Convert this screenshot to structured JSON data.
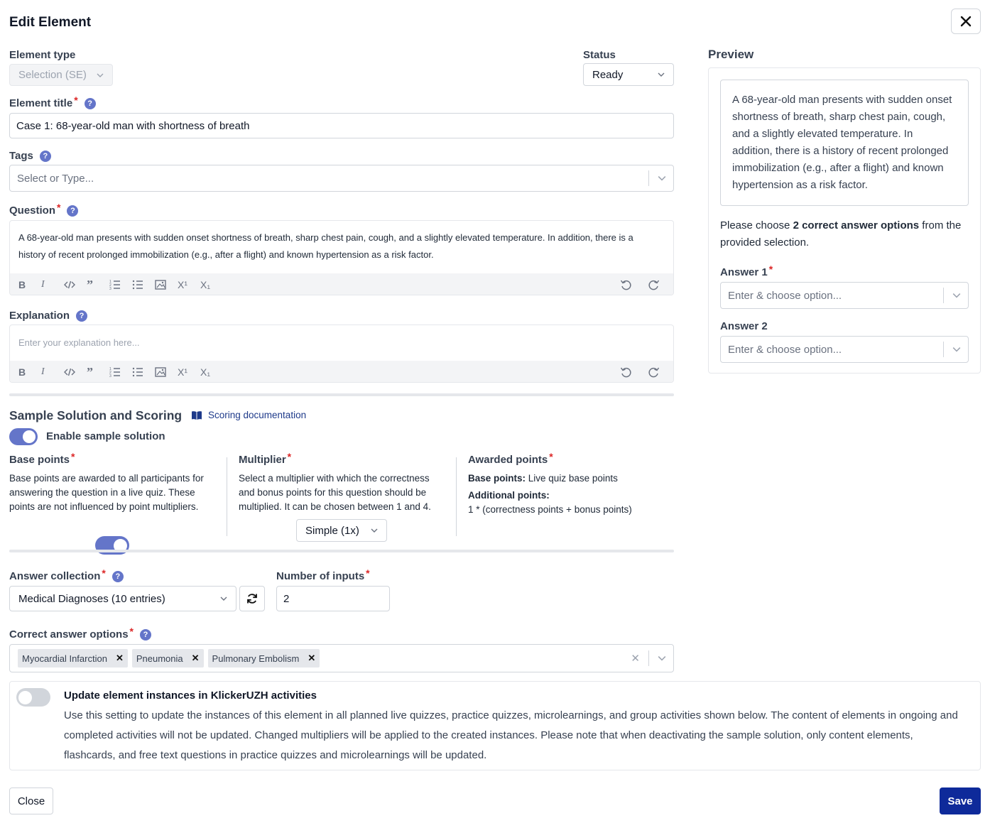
{
  "dialog": {
    "title": "Edit Element",
    "close_icon": "close-icon"
  },
  "element_type": {
    "label": "Element type",
    "value": "Selection (SE)"
  },
  "status": {
    "label": "Status",
    "value": "Ready"
  },
  "element_title": {
    "label": "Element title",
    "required": "*",
    "value": "Case 1: 68-year-old man with shortness of breath"
  },
  "tags": {
    "label": "Tags",
    "placeholder": "Select or Type..."
  },
  "question": {
    "label": "Question",
    "required": "*",
    "line1": "A 68-year-old man presents with sudden onset shortness of breath, sharp chest pain, cough, and a slightly elevated temperature. In addition, there is a",
    "line2": "history of recent prolonged immobilization (e.g., after a flight) and known hypertension as a risk factor."
  },
  "explanation": {
    "label": "Explanation",
    "placeholder": "Enter your explanation here..."
  },
  "toolbar": {
    "bold": "B",
    "italic": "I",
    "superscript": "X¹",
    "subscript": "X₁"
  },
  "scoring": {
    "title": "Sample Solution and Scoring",
    "doc_link": "Scoring documentation",
    "enable_label": "Enable sample solution",
    "base_points_label": "Base points",
    "base_points_desc": "Base points are awarded to all participants for answering the question in a live quiz. These points are not influenced by point multipliers.",
    "multiplier_label": "Multiplier",
    "multiplier_desc": "Select a multiplier with which the correctness and bonus points for this question should be multiplied. It can be chosen between 1 and 4.",
    "multiplier_value": "Simple (1x)",
    "awarded_label": "Awarded points",
    "awarded_base_key": "Base points:",
    "awarded_base_val": "Live quiz base points",
    "awarded_additional_key": "Additional points:",
    "awarded_additional_val": "1 * (correctness points + bonus points)"
  },
  "answer_collection": {
    "label": "Answer collection",
    "value": "Medical Diagnoses (10 entries)"
  },
  "number_of_inputs": {
    "label": "Number of inputs",
    "value": "2"
  },
  "correct_answers": {
    "label": "Correct answer options",
    "items": [
      "Myocardial Infarction",
      "Pneumonia",
      "Pulmonary Embolism"
    ]
  },
  "update_instances": {
    "title": "Update element instances in KlickerUZH activities",
    "line1": "Use this setting to update the instances of this element in all planned live quizzes, practice quizzes, microlearnings, and group activities shown below. The content of elements in ongoing and",
    "line2": "completed activities will not be updated. Changed multipliers will be applied to the created instances. Please note that when deactivating the sample solution, only content elements,",
    "line3": "flashcards, and free text questions in practice quizzes and microlearnings will be updated."
  },
  "footer": {
    "close": "Close",
    "save": "Save"
  },
  "preview": {
    "title": "Preview",
    "lines": [
      "A 68-year-old man presents with sudden onset",
      "shortness of breath, sharp chest pain, cough,",
      "and a slightly elevated temperature. In",
      "addition, there is a history of recent prolonged",
      "immobilization (e.g., after a flight) and known",
      "hypertension as a risk factor."
    ],
    "instruction_pre": "Please choose ",
    "instruction_bold": "2 correct answer options",
    "instruction_post": " from the",
    "instruction_line2": "provided selection.",
    "answer1_label": "Answer 1",
    "answer2_label": "Answer 2",
    "answer_placeholder": "Enter & choose option..."
  },
  "colors": {
    "accent": "#6475c9",
    "save": "#0e2a9a",
    "required": "#dc2626",
    "link": "#1e3a8a"
  }
}
